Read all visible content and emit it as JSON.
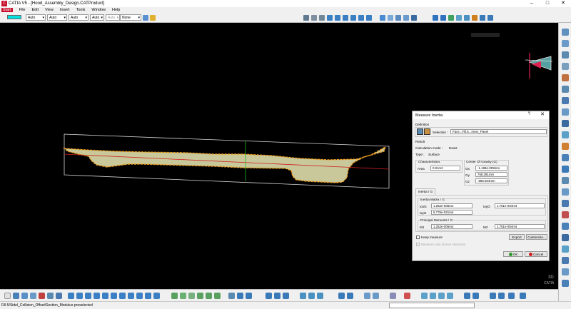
{
  "window": {
    "title": "CATIA V5 - [Hood_Assembly_Design.CATProduct]",
    "min": "–",
    "max": "□",
    "close": "✕"
  },
  "menu": [
    "Start",
    "File",
    "Edit",
    "View",
    "Insert",
    "Tools",
    "Window",
    "Help"
  ],
  "graphic_toolbar": {
    "line_type": "Auto",
    "thickness": "Auto",
    "point_symbol": "Auto",
    "layer_a": "Auto",
    "layer_b": "Auto",
    "layer_c": "Auto",
    "layer_none": "None",
    "swatch_color": "#00e0e0"
  },
  "dialog": {
    "title": "Measure Inertia",
    "help": "?",
    "close": "✕",
    "definition_label": "Definition",
    "selection_label": "Selection :",
    "selection_value": "Face...Fill.5...Inner_Panel",
    "result_label": "Result",
    "calc_mode_label": "Calculation mode :",
    "calc_mode_value": "Exact",
    "type_label": "Type :",
    "type_value": "Surface",
    "characteristics_label": "Characteristics",
    "area_label": "Area",
    "area_value": "0.01m2",
    "cog_label": "Center Of Gravity (G)",
    "gx_label": "Gx",
    "gx_value": "-1.199e-009mm",
    "gy_label": "Gy",
    "gy_value": "768.391mm",
    "gz_label": "Gz",
    "gz_value": "-895.504mm",
    "tab_label": "Inertia / G",
    "matrix_label": "Inertia Matrix / G",
    "ioxg_label": "IoxG",
    "ioxg_value": "1.252e-006m4",
    "ioyg_label": "IoyG",
    "ioyg_value": "1.751e-004m4",
    "ixyg_label": "IxyG",
    "ixyg_value": "6.776e-021m4",
    "principal_label": "Principal Moments / G",
    "m1_label": "M1",
    "m1_value": "1.252e-006m4",
    "m2_label": "M2",
    "m2_value": "1.751e-004m4",
    "keep_measure_label": "Keep measure",
    "measure_shown_label": "Measure only shown elements",
    "export_label": "Export",
    "customize_label": "Customize...",
    "ok_label": "OK",
    "cancel_label": "Cancel"
  },
  "status": {
    "message": "Fill.5/Sidel_Collision_Offset/Section_Modulus preselected"
  },
  "colors": {
    "profile_fill": "#c9c89a",
    "profile_edge": "#f0a020",
    "axis_red": "#d02020",
    "axis_green": "#20c020",
    "catia_red": "#c8102e"
  }
}
